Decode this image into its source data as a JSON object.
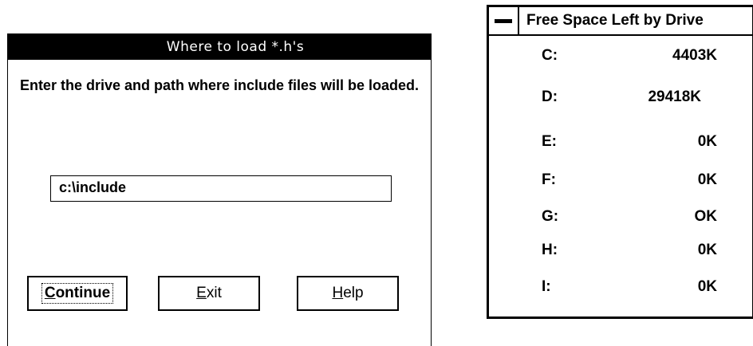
{
  "setup_dialog": {
    "title": "Where to load *.h's",
    "prompt": "Enter the drive and path where include files will be loaded.",
    "path_value": "c:\\include",
    "buttons": {
      "continue": {
        "mnemonic": "C",
        "rest": "ontinue"
      },
      "exit": {
        "mnemonic": "E",
        "rest": "xit"
      },
      "help": {
        "mnemonic": "H",
        "rest": "elp"
      }
    }
  },
  "free_space_panel": {
    "title": "Free Space Left by Drive",
    "drives": [
      {
        "letter": "C:",
        "space": "4403K"
      },
      {
        "letter": "D:",
        "space": "29418K"
      },
      {
        "letter": "E:",
        "space": "0K"
      },
      {
        "letter": "F:",
        "space": "0K"
      },
      {
        "letter": "G:",
        "space": "OK"
      },
      {
        "letter": "H:",
        "space": "0K"
      },
      {
        "letter": "I:",
        "space": "0K"
      }
    ]
  }
}
